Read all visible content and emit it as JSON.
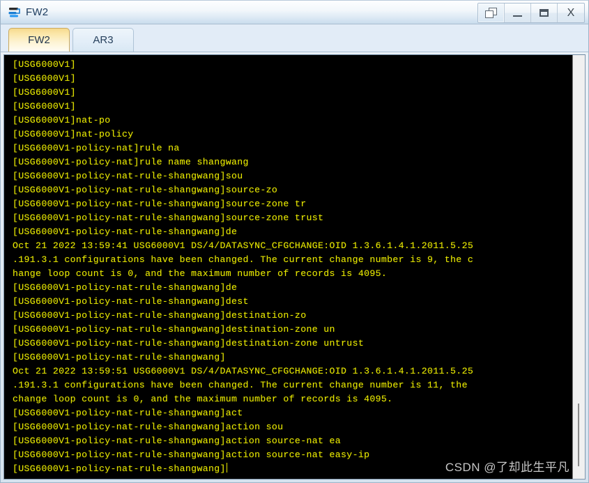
{
  "window": {
    "title": "FW2",
    "icon": "firewall-device-icon",
    "controls": [
      {
        "name": "restore-button",
        "label": "❐",
        "icon": "restore-window-icon",
        "active": true
      },
      {
        "name": "minimize-button",
        "label": "—",
        "icon": "minimize-icon",
        "active": false
      },
      {
        "name": "maximize-button",
        "label": "□",
        "icon": "maximize-icon",
        "active": false
      },
      {
        "name": "close-button",
        "label": "X",
        "icon": "close-icon",
        "active": false
      }
    ]
  },
  "tabs": [
    {
      "label": "FW2",
      "active": true
    },
    {
      "label": "AR3",
      "active": false
    }
  ],
  "terminal": {
    "foreground": "#e8e800",
    "background": "#000000",
    "lines": [
      "[USG6000V1]",
      "[USG6000V1]",
      "[USG6000V1]",
      "[USG6000V1]",
      "[USG6000V1]nat-po",
      "[USG6000V1]nat-policy",
      "[USG6000V1-policy-nat]rule na",
      "[USG6000V1-policy-nat]rule name shangwang",
      "[USG6000V1-policy-nat-rule-shangwang]sou",
      "[USG6000V1-policy-nat-rule-shangwang]source-zo",
      "[USG6000V1-policy-nat-rule-shangwang]source-zone tr",
      "[USG6000V1-policy-nat-rule-shangwang]source-zone trust",
      "[USG6000V1-policy-nat-rule-shangwang]de",
      "Oct 21 2022 13:59:41 USG6000V1 DS/4/DATASYNC_CFGCHANGE:OID 1.3.6.1.4.1.2011.5.25",
      ".191.3.1 configurations have been changed. The current change number is 9, the c",
      "hange loop count is 0, and the maximum number of records is 4095.",
      "[USG6000V1-policy-nat-rule-shangwang]de",
      "[USG6000V1-policy-nat-rule-shangwang]dest",
      "[USG6000V1-policy-nat-rule-shangwang]destination-zo",
      "[USG6000V1-policy-nat-rule-shangwang]destination-zone un",
      "[USG6000V1-policy-nat-rule-shangwang]destination-zone untrust",
      "[USG6000V1-policy-nat-rule-shangwang]",
      "Oct 21 2022 13:59:51 USG6000V1 DS/4/DATASYNC_CFGCHANGE:OID 1.3.6.1.4.1.2011.5.25",
      ".191.3.1 configurations have been changed. The current change number is 11, the",
      "change loop count is 0, and the maximum number of records is 4095.",
      "[USG6000V1-policy-nat-rule-shangwang]act",
      "[USG6000V1-policy-nat-rule-shangwang]action sou",
      "[USG6000V1-policy-nat-rule-shangwang]action source-nat ea",
      "[USG6000V1-policy-nat-rule-shangwang]action source-nat easy-ip"
    ],
    "prompt_line": "[USG6000V1-policy-nat-rule-shangwang]"
  },
  "watermark": {
    "text": "CSDN @了却此生平凡"
  },
  "colors": {
    "terminal_fg": "#e8e800",
    "terminal_bg": "#000000",
    "active_tab": "#f6d98d",
    "title_text": "#1b3b5e"
  }
}
